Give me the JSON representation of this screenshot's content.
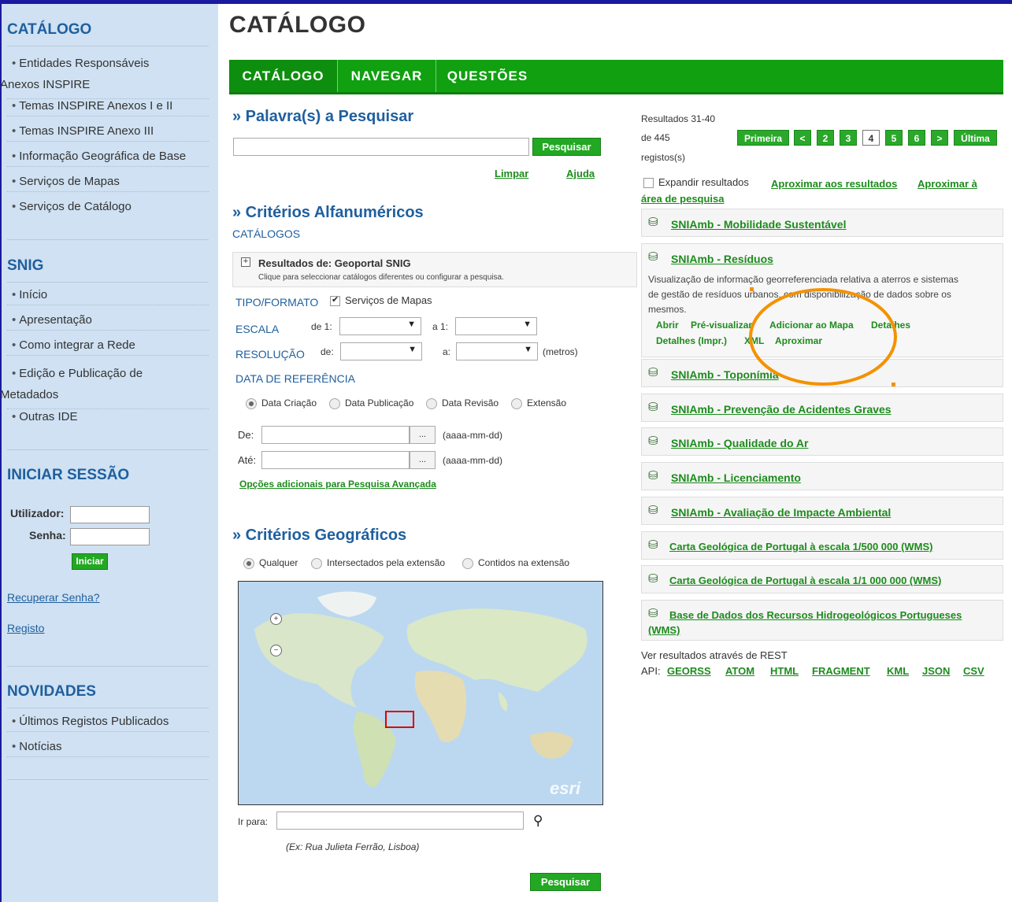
{
  "sidebar": {
    "catalog_heading": "CATÁLOGO",
    "catalog_items": [
      {
        "line1": "Entidades Responsáveis",
        "line2": "Anexos INSPIRE"
      },
      {
        "line1": "Temas INSPIRE Anexos I e II"
      },
      {
        "line1": "Temas INSPIRE Anexo III"
      },
      {
        "line1": "Informação Geográfica de Base"
      },
      {
        "line1": "Serviços de Mapas"
      },
      {
        "line1": "Serviços de Catálogo"
      }
    ],
    "snig_heading": "SNIG",
    "snig_items": [
      {
        "line1": "Início"
      },
      {
        "line1": "Apresentação"
      },
      {
        "line1": "Como integrar a Rede"
      },
      {
        "line1": "Edição e Publicação de",
        "line2": "Metadados"
      },
      {
        "line1": "Outras IDE"
      }
    ],
    "login_heading": "INICIAR SESSÃO",
    "user_label": "Utilizador:",
    "password_label": "Senha:",
    "login_button": "Iniciar",
    "recover_link": "Recuperar Senha?",
    "register_link": "Registo",
    "news_heading": "NOVIDADES",
    "news_items": [
      {
        "line1": "Últimos Registos Publicados"
      },
      {
        "line1": "Notícias"
      }
    ]
  },
  "main": {
    "title": "CATÁLOGO",
    "tabs": [
      "CATÁLOGO",
      "NAVEGAR",
      "QUESTÕES"
    ]
  },
  "search": {
    "heading": "» Palavra(s) a Pesquisar",
    "button": "Pesquisar",
    "clear": "Limpar",
    "help": "Ajuda"
  },
  "alpha": {
    "heading": "» Critérios Alfanuméricos",
    "catalogs_label": "CATÁLOGOS",
    "catalog_box_title": "Resultados de: Geoportal SNIG",
    "catalog_box_sub": "Clique para seleccionar catálogos diferentes ou configurar a pesquisa.",
    "type_label": "TIPO/FORMATO",
    "type_option": "Serviços de Mapas",
    "scale_label": "ESCALA",
    "scale_from": "de 1:",
    "scale_to": "a 1:",
    "resolution_label": "RESOLUÇÃO",
    "res_from": "de:",
    "res_to": "a:",
    "res_unit": "(metros)",
    "date_label": "DATA DE REFERÊNCIA",
    "date_options": [
      "Data Criação",
      "Data Publicação",
      "Data Revisão",
      "Extensão"
    ],
    "from_label": "De:",
    "to_label": "Até:",
    "date_btn": "...",
    "date_format": "(aaaa-mm-dd)",
    "advanced_link": "Opções adicionais para Pesquisa Avançada"
  },
  "geo": {
    "heading": "» Critérios Geográficos",
    "options": [
      "Qualquer",
      "Intersectados pela extensão",
      "Contidos na extensão"
    ],
    "map_brand": "esri",
    "goto_label": "Ir para:",
    "goto_example": "(Ex: Rua Julieta Ferrão, Lisboa)",
    "search_button": "Pesquisar"
  },
  "results": {
    "range": "Resultados 31-40",
    "of": "de 445",
    "records": "registos(s)",
    "pager": {
      "first": "Primeira",
      "prev": "<",
      "pages": [
        "2",
        "3",
        "4",
        "5",
        "6"
      ],
      "current": "4",
      "next": ">",
      "last": "Última"
    },
    "expand_label": "Expandir resultados",
    "zoom_results": "Aproximar aos resultados",
    "zoom_area": "Aproximar à",
    "zoom_area2": "área de pesquisa",
    "items": [
      "SNIAmb - Mobilidade Sustentável",
      "SNIAmb - Resíduos",
      "SNIAmb - Toponímia",
      "SNIAmb - Prevenção de Acidentes Graves",
      "SNIAmb - Qualidade do Ar",
      "SNIAmb - Licenciamento",
      "SNIAmb - Avaliação de Impacte Ambiental",
      "Carta Geológica de Portugal à escala 1/500 000 (WMS)",
      "Carta Geológica de Portugal à escala 1/1 000 000 (WMS)",
      "Base de Dados dos Recursos Hidrogeológicos Portugueses",
      "(WMS)"
    ],
    "expanded_desc": [
      "Visualização de informação georreferenciada relativa a aterros e sistemas",
      "de gestão de resíduos urbanos, com disponibilização de dados sobre os",
      "mesmos."
    ],
    "actions": [
      "Abrir",
      "Pré-visualizar",
      "Adicionar ao Mapa",
      "Detalhes",
      "Detalhes (Impr.)",
      "XML",
      "Aproximar"
    ],
    "rest_line1": "Ver resultados através de REST",
    "rest_api": "API:",
    "rest_formats": [
      "GEORSS",
      "ATOM",
      "HTML",
      "FRAGMENT",
      "KML",
      "JSON",
      "CSV"
    ]
  },
  "colors": {
    "accent_green": "#10a010",
    "heading_blue": "#1f5f9e",
    "sidebar_bg": "#cfe1f2",
    "annotation_orange": "#f39200"
  }
}
